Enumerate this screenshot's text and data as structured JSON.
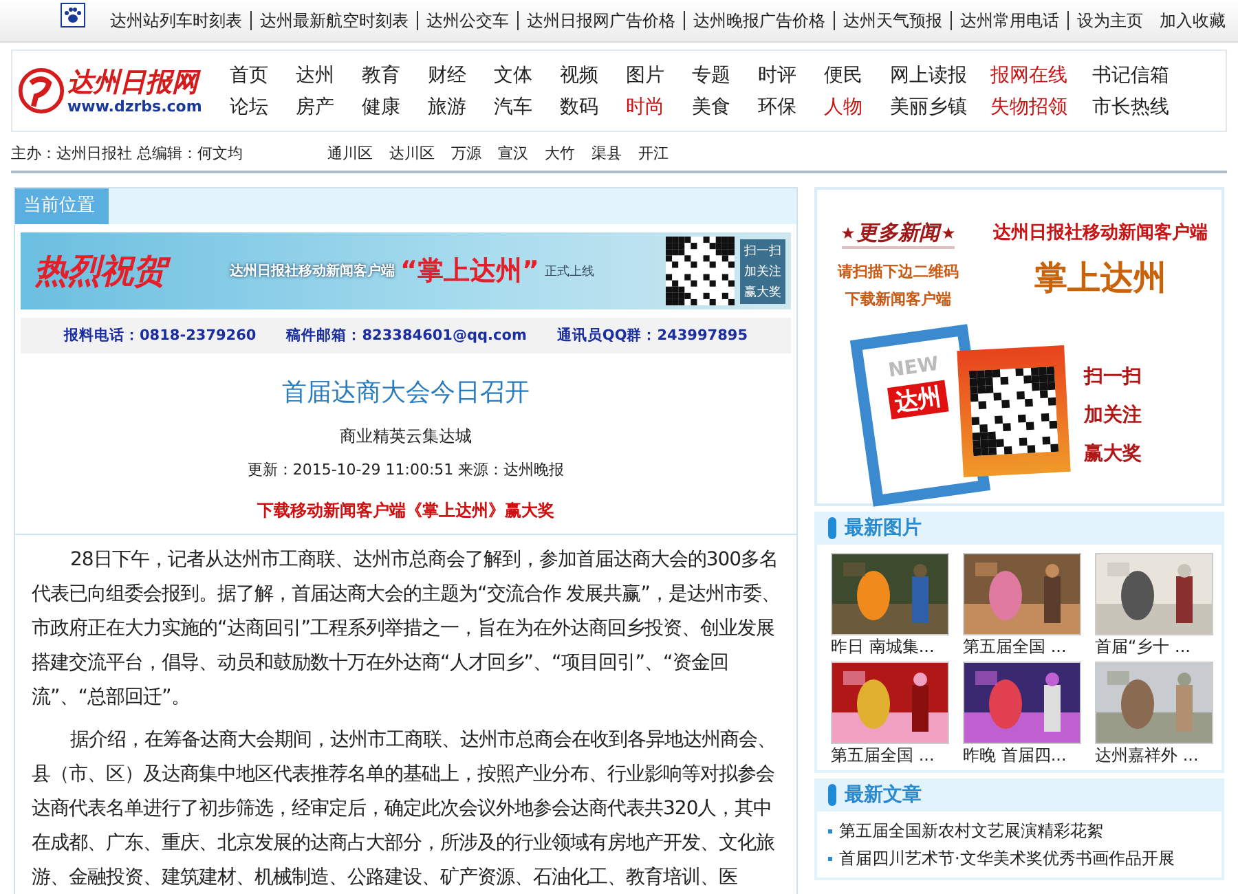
{
  "top_links": [
    "达州站列车时刻表",
    "达州最新航空时刻表",
    "达州公交车",
    "达州日报网广告价格",
    "达州晚报广告价格",
    "达州天气预报",
    "达州常用电话",
    "设为主页",
    "加入收藏"
  ],
  "logo": {
    "name": "达州日报网",
    "url": "www.dzrbs.com"
  },
  "nav": [
    {
      "label": "首页",
      "hot": false
    },
    {
      "label": "达州",
      "hot": false
    },
    {
      "label": "教育",
      "hot": false
    },
    {
      "label": "财经",
      "hot": false
    },
    {
      "label": "文体",
      "hot": false
    },
    {
      "label": "视频",
      "hot": false
    },
    {
      "label": "图片",
      "hot": false
    },
    {
      "label": "专题",
      "hot": false
    },
    {
      "label": "时评",
      "hot": false
    },
    {
      "label": "便民",
      "hot": false
    },
    {
      "label": "网上读报",
      "hot": false
    },
    {
      "label": "报网在线",
      "hot": true
    },
    {
      "label": "书记信箱",
      "hot": false
    },
    {
      "label": "论坛",
      "hot": false
    },
    {
      "label": "房产",
      "hot": false
    },
    {
      "label": "健康",
      "hot": false
    },
    {
      "label": "旅游",
      "hot": false
    },
    {
      "label": "汽车",
      "hot": false
    },
    {
      "label": "数码",
      "hot": false
    },
    {
      "label": "时尚",
      "hot": true
    },
    {
      "label": "美食",
      "hot": false
    },
    {
      "label": "环保",
      "hot": false
    },
    {
      "label": "人物",
      "hot": true
    },
    {
      "label": "美丽乡镇",
      "hot": false
    },
    {
      "label": "失物招领",
      "hot": true
    },
    {
      "label": "市长热线",
      "hot": false
    }
  ],
  "sub_bar": {
    "publisher": "主办：达州日报社 总编辑：何文均",
    "districts": [
      "通川区",
      "达川区",
      "万源",
      "宣汉",
      "大竹",
      "渠县",
      "开江"
    ]
  },
  "breadcrumb": "当前位置",
  "banner": {
    "headline": "热烈祝贺",
    "caption": "达州日报社移动新闻客户端",
    "app_name": "“掌上达州”",
    "suffix": "正式上线",
    "side": [
      "扫一扫",
      "加关注",
      "赢大奖"
    ]
  },
  "contacts": [
    "报料电话：0818-2379260",
    "稿件邮箱：823384601@qq.com",
    "通讯员QQ群：243997895"
  ],
  "article": {
    "title": "首届达商大会今日召开",
    "subtitle": "商业精英云集达城",
    "meta": "更新：2015-10-29 11:00:51 来源：达州晚报",
    "promo": "下载移动新闻客户端《掌上达州》赢大奖",
    "paragraphs": [
      "28日下午，记者从达州市工商联、达州市总商会了解到，参加首届达商大会的300多名代表已向组委会报到。据了解，首届达商大会的主题为“交流合作 发展共赢”，是达州市委、市政府正在大力实施的“达商回引”工程系列举措之一，旨在为在外达商回乡投资、创业发展搭建交流平台，倡导、动员和鼓励数十万在外达商“人才回乡”、“项目回引”、“资金回流”、“总部回迁”。",
      "据介绍，在筹备达商大会期间，达州市工商联、达州市总商会在收到各异地达州商会、县（市、区）及达商集中地区代表推荐名单的基础上，按照产业分布、行业影响等对拟参会达商代表名单进行了初步筛选，经审定后，确定此次会议外地参会达商代表共320人，其中在成都、广东、重庆、北京发展的达商占大部分，所涉及的行业领域有房地产开发、文化旅游、金融投资、建筑建材、机械制造、公路建设、矿产资源、石油化工、教育培训、医"
    ]
  },
  "ad": {
    "more": "更多新闻",
    "hint_lines": [
      "请扫描下边二维码",
      "下载新闻客户端"
    ],
    "caption": "达州日报社移动新闻客户端",
    "app_name": "掌上达州",
    "card_new": "NEW",
    "card_city": "达州",
    "side": [
      "扫一扫",
      "加关注",
      "赢大奖"
    ]
  },
  "latest_photos": {
    "title": "最新图片",
    "items": [
      {
        "caption": "昨日 南城集..."
      },
      {
        "caption": "第五届全国 ..."
      },
      {
        "caption": "首届“乡十 ..."
      },
      {
        "caption": "第五届全国 ..."
      },
      {
        "caption": "昨晚 首届四..."
      },
      {
        "caption": "达州嘉祥外 ..."
      }
    ]
  },
  "latest_articles": {
    "title": "最新文章",
    "items": [
      "第五届全国新农村文艺展演精彩花絮",
      "首届四川艺术节·文华美术奖优秀书画作品开展"
    ]
  }
}
